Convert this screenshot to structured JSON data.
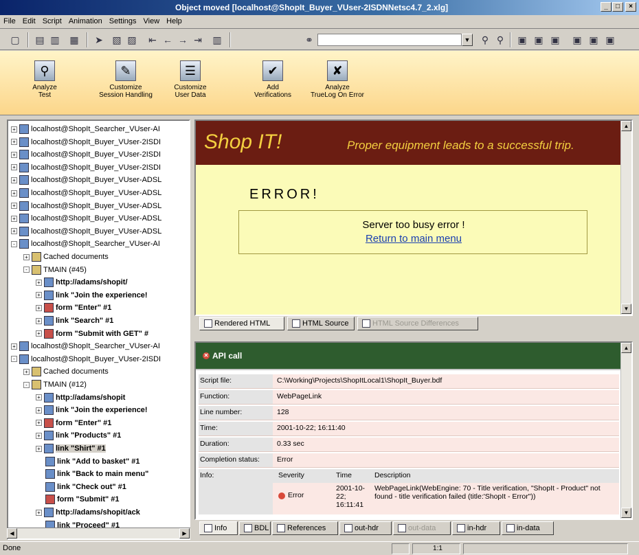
{
  "window": {
    "title": "Object moved [localhost@ShopIt_Buyer_VUser-2ISDNNetsc4.7_2.xlg]",
    "btn_min": "_",
    "btn_max": "□",
    "btn_close": "×"
  },
  "menu": [
    "File",
    "Edit",
    "Script",
    "Animation",
    "Settings",
    "View",
    "Help"
  ],
  "toolbar": {
    "search_value": ""
  },
  "workflow": [
    {
      "label": "Analyze\nTest",
      "icon": "magnifier-icon"
    },
    {
      "label": "Customize\nSession Handling",
      "icon": "session-icon"
    },
    {
      "label": "Customize\nUser Data",
      "icon": "userdata-icon"
    },
    {
      "label": "Add\nVerifications",
      "icon": "verify-icon"
    },
    {
      "label": "Analyze\nTrueLog On Error",
      "icon": "truelog-icon"
    }
  ],
  "tree": [
    {
      "label": "localhost@ShopIt_Searcher_VUser-AI",
      "indent": 0,
      "pm": "+",
      "bold": false
    },
    {
      "label": "localhost@ShopIt_Buyer_VUser-2ISDI",
      "indent": 0,
      "pm": "+",
      "bold": false
    },
    {
      "label": "localhost@ShopIt_Buyer_VUser-2ISDI",
      "indent": 0,
      "pm": "+",
      "bold": false
    },
    {
      "label": "localhost@ShopIt_Buyer_VUser-2ISDI",
      "indent": 0,
      "pm": "+",
      "bold": false
    },
    {
      "label": "localhost@ShopIt_Buyer_VUser-ADSL",
      "indent": 0,
      "pm": "+",
      "bold": false
    },
    {
      "label": "localhost@ShopIt_Buyer_VUser-ADSL",
      "indent": 0,
      "pm": "+",
      "bold": false
    },
    {
      "label": "localhost@ShopIt_Buyer_VUser-ADSL",
      "indent": 0,
      "pm": "+",
      "bold": false
    },
    {
      "label": "localhost@ShopIt_Buyer_VUser-ADSL",
      "indent": 0,
      "pm": "+",
      "bold": false
    },
    {
      "label": "localhost@ShopIt_Buyer_VUser-ADSL",
      "indent": 0,
      "pm": "+",
      "bold": false
    },
    {
      "label": "localhost@ShopIt_Searcher_VUser-AI",
      "indent": 0,
      "pm": "-",
      "bold": false
    },
    {
      "label": "Cached documents",
      "indent": 1,
      "pm": "+",
      "bold": false
    },
    {
      "label": "TMAIN (#45)",
      "indent": 1,
      "pm": "-",
      "bold": false
    },
    {
      "label": "http://adams/shopit/",
      "indent": 2,
      "pm": "+",
      "bold": true
    },
    {
      "label": "link \"Join the experience!",
      "indent": 2,
      "pm": "+",
      "bold": true
    },
    {
      "label": "form \"Enter\" #1",
      "indent": 2,
      "pm": "+",
      "bold": true
    },
    {
      "label": "link \"Search\" #1",
      "indent": 2,
      "pm": "+",
      "bold": true
    },
    {
      "label": "form \"Submit with GET\" #",
      "indent": 2,
      "pm": "+",
      "bold": true
    },
    {
      "label": "localhost@ShopIt_Searcher_VUser-AI",
      "indent": 0,
      "pm": "+",
      "bold": false
    },
    {
      "label": "localhost@ShopIt_Buyer_VUser-2ISDI",
      "indent": 0,
      "pm": "-",
      "bold": false
    },
    {
      "label": "Cached documents",
      "indent": 1,
      "pm": "+",
      "bold": false
    },
    {
      "label": "TMAIN (#12)",
      "indent": 1,
      "pm": "-",
      "bold": false
    },
    {
      "label": "http://adams/shopit",
      "indent": 2,
      "pm": "+",
      "bold": true
    },
    {
      "label": "link \"Join the experience!",
      "indent": 2,
      "pm": "+",
      "bold": true
    },
    {
      "label": "form \"Enter\" #1",
      "indent": 2,
      "pm": "+",
      "bold": true
    },
    {
      "label": "link \"Products\" #1",
      "indent": 2,
      "pm": "+",
      "bold": true
    },
    {
      "label": "link \"Shirt\" #1",
      "indent": 2,
      "pm": "+",
      "bold": true,
      "selected": true
    },
    {
      "label": "link \"Add to basket\" #1",
      "indent": 2,
      "pm": "",
      "bold": true
    },
    {
      "label": "link \"Back to main menu\"",
      "indent": 2,
      "pm": "",
      "bold": true
    },
    {
      "label": "link \"Check out\" #1",
      "indent": 2,
      "pm": "",
      "bold": true
    },
    {
      "label": "form \"Submit\" #1",
      "indent": 2,
      "pm": "",
      "bold": true
    },
    {
      "label": "http://adams/shopit/ack",
      "indent": 2,
      "pm": "+",
      "bold": true
    },
    {
      "label": "link \"Proceed\" #1",
      "indent": 2,
      "pm": "",
      "bold": true
    }
  ],
  "browser": {
    "logo": "Shop IT!",
    "tagline": "Proper equipment leads to a successful trip.",
    "error_title": "ERROR!",
    "error_message": "Server too busy error !",
    "error_link": "Return to main menu"
  },
  "browser_tabs": [
    "Rendered HTML",
    "HTML Source",
    "HTML Source Differences"
  ],
  "api": {
    "header": "API call",
    "rows": [
      {
        "k": "Script file:",
        "v": "C:\\Working\\Projects\\ShopItLocal1\\ShopIt_Buyer.bdf"
      },
      {
        "k": "Function:",
        "v": "WebPageLink"
      },
      {
        "k": "Line number:",
        "v": "128"
      },
      {
        "k": "Time:",
        "v": "2001-10-22; 16:11:40"
      },
      {
        "k": "Duration:",
        "v": "0.33 sec"
      },
      {
        "k": "Completion status:",
        "v": "Error"
      }
    ],
    "info_label": "Info:",
    "info_cols": [
      "Severity",
      "Time",
      "Description"
    ],
    "info_severity": "Error",
    "info_time": "2001-10-22; 16:11:41",
    "info_desc": "WebPageLink(WebEngine: 70 - Title verification, \"ShopIt - Product\" not found - title verification failed (title:'ShopIt - Error\"))"
  },
  "bottom_tabs": [
    "Info",
    "BDL",
    "References",
    "out-hdr",
    "out-data",
    "in-hdr",
    "in-data"
  ],
  "status": {
    "text": "Done",
    "pos": "1:1"
  }
}
